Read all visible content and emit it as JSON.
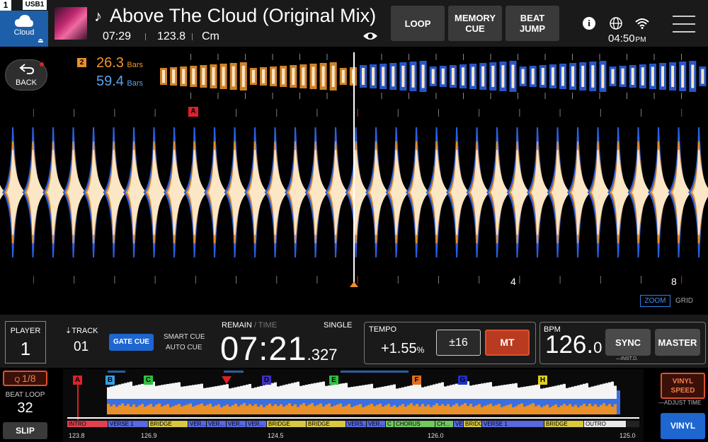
{
  "header": {
    "deck_number": "1",
    "source": {
      "badge": "USB1",
      "label": "Cloud",
      "icon": "cloud-icon"
    },
    "track_title": "Above The Cloud (Original Mix)",
    "elapsed_time": "07:29",
    "bpm": "123.8",
    "key": "Cm",
    "buttons": {
      "loop": "LOOP",
      "memory_cue_1": "MEMORY",
      "memory_cue_2": "CUE",
      "beat_jump_1": "BEAT",
      "beat_jump_2": "JUMP"
    },
    "clock": "04:50",
    "clock_ampm": "PM"
  },
  "overview": {
    "back_label": "BACK",
    "linked_deck": "2",
    "bars_primary": "26.3",
    "bars_secondary": "59.4",
    "bars_unit": "Bars"
  },
  "waveform": {
    "cue_marker": "A",
    "beat_labels": [
      "4",
      "8"
    ],
    "zoom_label": "ZOOM",
    "grid_label": "GRID",
    "colors": {
      "blue": "#2a5fe0",
      "orange": "#e8902a",
      "cream": "#fbe6c6"
    }
  },
  "info_bar": {
    "player_label": "PLAYER",
    "player_number": "1",
    "track_label": "TRACK",
    "track_number": "01",
    "gate_cue": "GATE CUE",
    "smart_cue": "SMART CUE",
    "auto_cue": "AUTO CUE",
    "remain_label": "REMAIN",
    "time_label": "TIME",
    "single_label": "SINGLE",
    "time_main": "07:21",
    "time_ms": ".327",
    "tempo_label": "TEMPO",
    "tempo_value": "+1.55",
    "tempo_unit": "%",
    "tempo_range": "±16",
    "mt_label": "MT",
    "bpm_label": "BPM",
    "bpm_main": "126.",
    "bpm_decimal": "0",
    "sync_label": "SYNC",
    "inst_label": "INST.D.",
    "master_label": "MASTER"
  },
  "bottom": {
    "quantize_label": "1/8",
    "beat_loop_label": "BEAT LOOP",
    "beat_loop_value": "32",
    "slip_label": "SLIP",
    "vinyl_speed_1": "VINYL",
    "vinyl_speed_2": "SPEED",
    "adjust_time": "ADJUST TIME",
    "vinyl_label": "VINYL",
    "hot_cues": [
      {
        "label": "A",
        "color": "#e0202a"
      },
      {
        "label": "B",
        "color": "#3aa0e0"
      },
      {
        "label": "C",
        "color": "#30c040"
      },
      {
        "label": "D",
        "color": "#4030c0"
      },
      {
        "label": "E",
        "color": "#30c040"
      },
      {
        "label": "F",
        "color": "#e07020"
      },
      {
        "label": "G",
        "color": "#2030c0"
      },
      {
        "label": "H",
        "color": "#e0d020"
      }
    ],
    "sections": [
      {
        "label": "INTRO",
        "color": "#e04050"
      },
      {
        "label": "VERSE 1",
        "color": "#5868e0"
      },
      {
        "label": "BRIDGE",
        "color": "#d8c840"
      },
      {
        "label": "VER...",
        "color": "#5868e0"
      },
      {
        "label": "VER...",
        "color": "#5868e0"
      },
      {
        "label": "VER...",
        "color": "#5868e0"
      },
      {
        "label": "VER...",
        "color": "#5868e0"
      },
      {
        "label": "BRIDGE",
        "color": "#d8c840"
      },
      {
        "label": "BRIDGE",
        "color": "#d8c840"
      },
      {
        "label": "VERS...",
        "color": "#5868e0"
      },
      {
        "label": "VER...",
        "color": "#5868e0"
      },
      {
        "label": "C",
        "color": "#70c860"
      },
      {
        "label": "CHORUS",
        "color": "#70c860"
      },
      {
        "label": "CH...",
        "color": "#70c860"
      },
      {
        "label": "VE",
        "color": "#5868e0"
      },
      {
        "label": "BRIDGE",
        "color": "#d8c840"
      },
      {
        "label": "VERSE 1",
        "color": "#5868e0"
      },
      {
        "label": "BRIDGE",
        "color": "#d8c840"
      },
      {
        "label": "OUTRO",
        "color": "#e8e8e8"
      }
    ],
    "tempo_marks": [
      "123.8",
      "126.9",
      "124.5",
      "126.0",
      "125.0"
    ]
  }
}
